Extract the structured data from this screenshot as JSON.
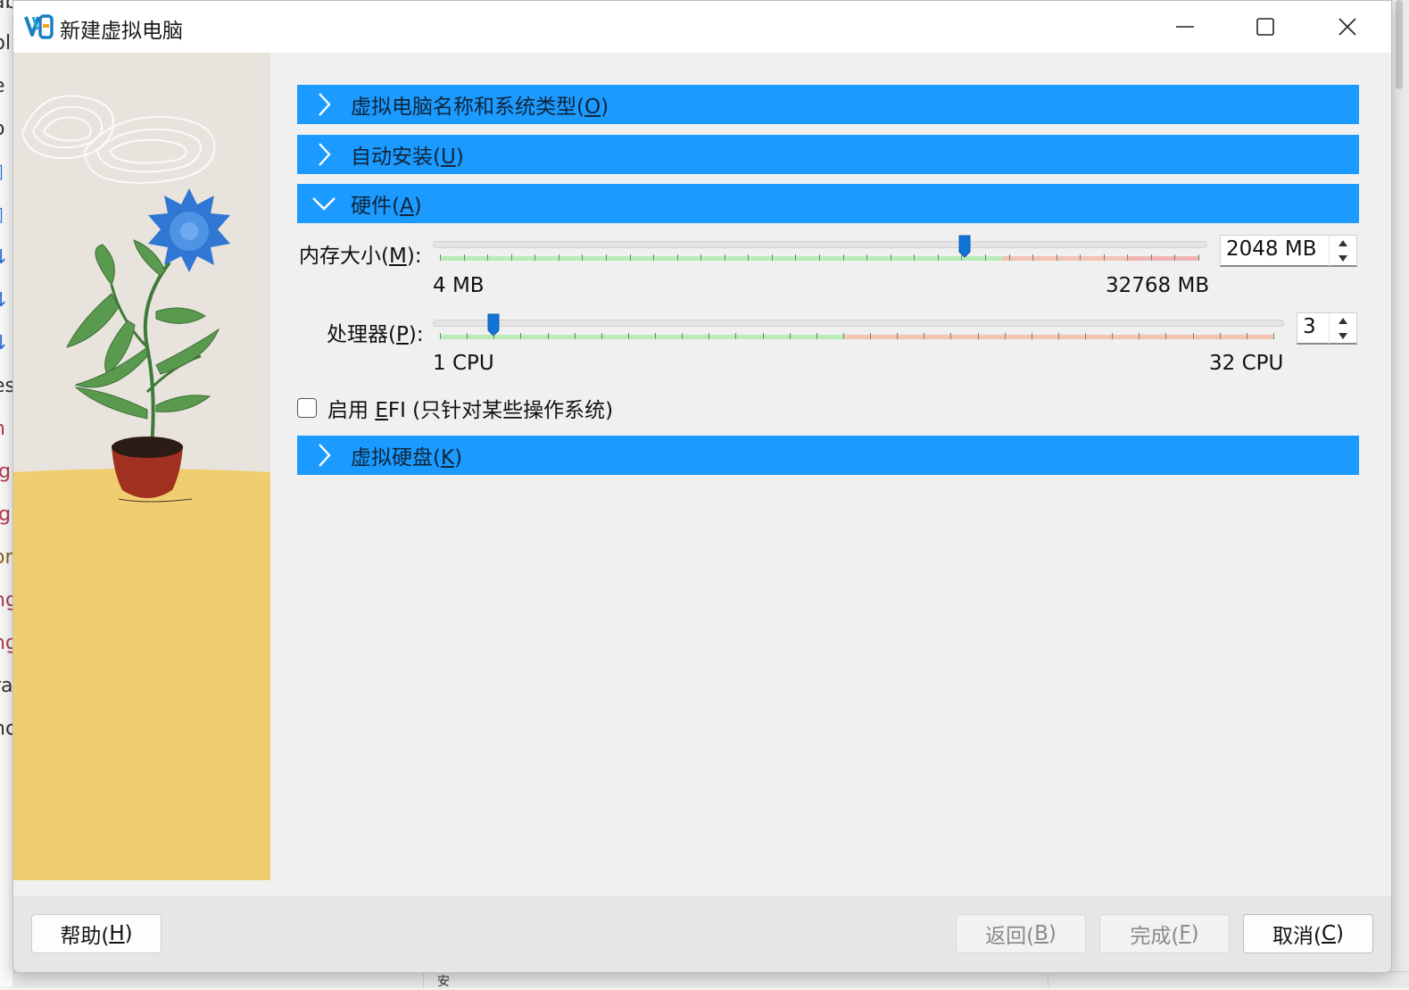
{
  "window": {
    "title": "新建虚拟电脑",
    "controls": [
      "minimize-icon",
      "maximize-icon",
      "close-icon"
    ]
  },
  "background_app": {
    "fragments": [
      "ab",
      "bl",
      "e",
      "o",
      "es",
      "n",
      "ig",
      "ig",
      "or",
      "ng",
      "ng",
      "ra",
      "nc"
    ],
    "bottom_text": "安"
  },
  "sections": {
    "name_os": {
      "text": "虚拟电脑名称和系统类型(",
      "key": "O",
      "end": ")",
      "expanded": false
    },
    "auto_install": {
      "text": "自动安装(",
      "key": "U",
      "end": ")",
      "expanded": false
    },
    "hardware": {
      "text": "硬件(",
      "key": "A",
      "end": ")",
      "expanded": true
    },
    "virtual_disk": {
      "text": "虚拟硬盘(",
      "key": "K",
      "end": ")",
      "expanded": false
    }
  },
  "hardware": {
    "memory": {
      "label_pre": "内存大小(",
      "label_key": "M",
      "label_post": "):",
      "value": "2048 MB",
      "value_mb": 2048,
      "min_label": "4 MB",
      "max_label": "32768 MB",
      "min": 4,
      "max": 32768
    },
    "cpu": {
      "label_pre": "处理器(",
      "label_key": "P",
      "label_post": "):",
      "value": "3",
      "value_count": 3,
      "min_label": "1 CPU",
      "max_label": "32 CPU",
      "min": 1,
      "max": 32
    },
    "efi": {
      "pre": "启用 ",
      "key": "E",
      "post": "FI (只针对某些操作系统)",
      "checked": false
    }
  },
  "footer": {
    "help": {
      "pre": "帮助(",
      "key": "H",
      "post": ")",
      "enabled": true
    },
    "back": {
      "pre": "返回(",
      "key": "B",
      "post": ")",
      "enabled": false
    },
    "finish": {
      "pre": "完成(",
      "key": "F",
      "post": ")",
      "enabled": false
    },
    "cancel": {
      "pre": "取消(",
      "key": "C",
      "post": ")",
      "enabled": true
    }
  },
  "colors": {
    "section_bar": "#1b9aff",
    "slider_thumb": "#1273d6",
    "slider_ok": "#b9ecb9",
    "slider_warn": "#f4c3b3",
    "slider_bad": "#f2b3b3",
    "art_floor": "#f0cd6e",
    "art_wall": "#e8e4dd"
  }
}
